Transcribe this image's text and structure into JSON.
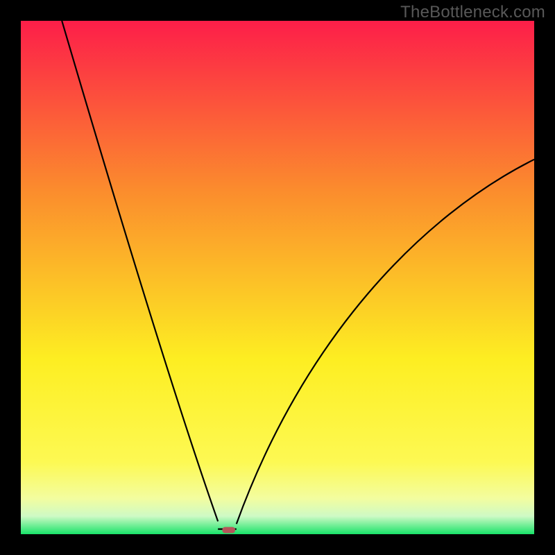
{
  "watermark": "TheBottleneck.com",
  "colors": {
    "frame": "#000000",
    "curve": "#000000",
    "marker": "#b6565a",
    "gradient_top": "#fd1e49",
    "gradient_mid_upper": "#fb8c2d",
    "gradient_mid": "#fdee22",
    "gradient_lowerA": "#fdf953",
    "gradient_lowerB": "#f3fd9f",
    "gradient_lowerC": "#cefac5",
    "gradient_bottom": "#18e369"
  },
  "chart_data": {
    "type": "line",
    "title": "",
    "xlabel": "",
    "ylabel": "",
    "xlim": [
      0,
      100
    ],
    "ylim": [
      0,
      100
    ],
    "optimum_x": 40,
    "marker": {
      "x": 40.5,
      "y": 0.8,
      "w": 2.5,
      "h": 1.2
    },
    "left_branch": {
      "start": {
        "x": 8,
        "y": 100
      },
      "end": {
        "x": 38.4,
        "y": 2.5
      },
      "control": {
        "x": 28,
        "y": 32
      }
    },
    "flat": {
      "start": {
        "x": 38.4,
        "y": 1
      },
      "end": {
        "x": 42.0,
        "y": 1
      }
    },
    "right_branch": {
      "start": {
        "x": 42.0,
        "y": 2
      },
      "c1": {
        "x": 55,
        "y": 38
      },
      "c2": {
        "x": 78,
        "y": 62
      },
      "end": {
        "x": 100,
        "y": 73
      }
    },
    "series": [
      {
        "name": "bottleneck-curve",
        "x": [
          8,
          12,
          16,
          20,
          24,
          28,
          32,
          36,
          38.4,
          40,
          42,
          46,
          52,
          60,
          70,
          82,
          92,
          100
        ],
        "values": [
          100,
          86,
          73,
          60,
          47,
          35,
          22,
          9,
          2.5,
          1,
          2,
          14,
          28,
          42,
          54,
          64,
          70,
          73
        ]
      }
    ]
  }
}
